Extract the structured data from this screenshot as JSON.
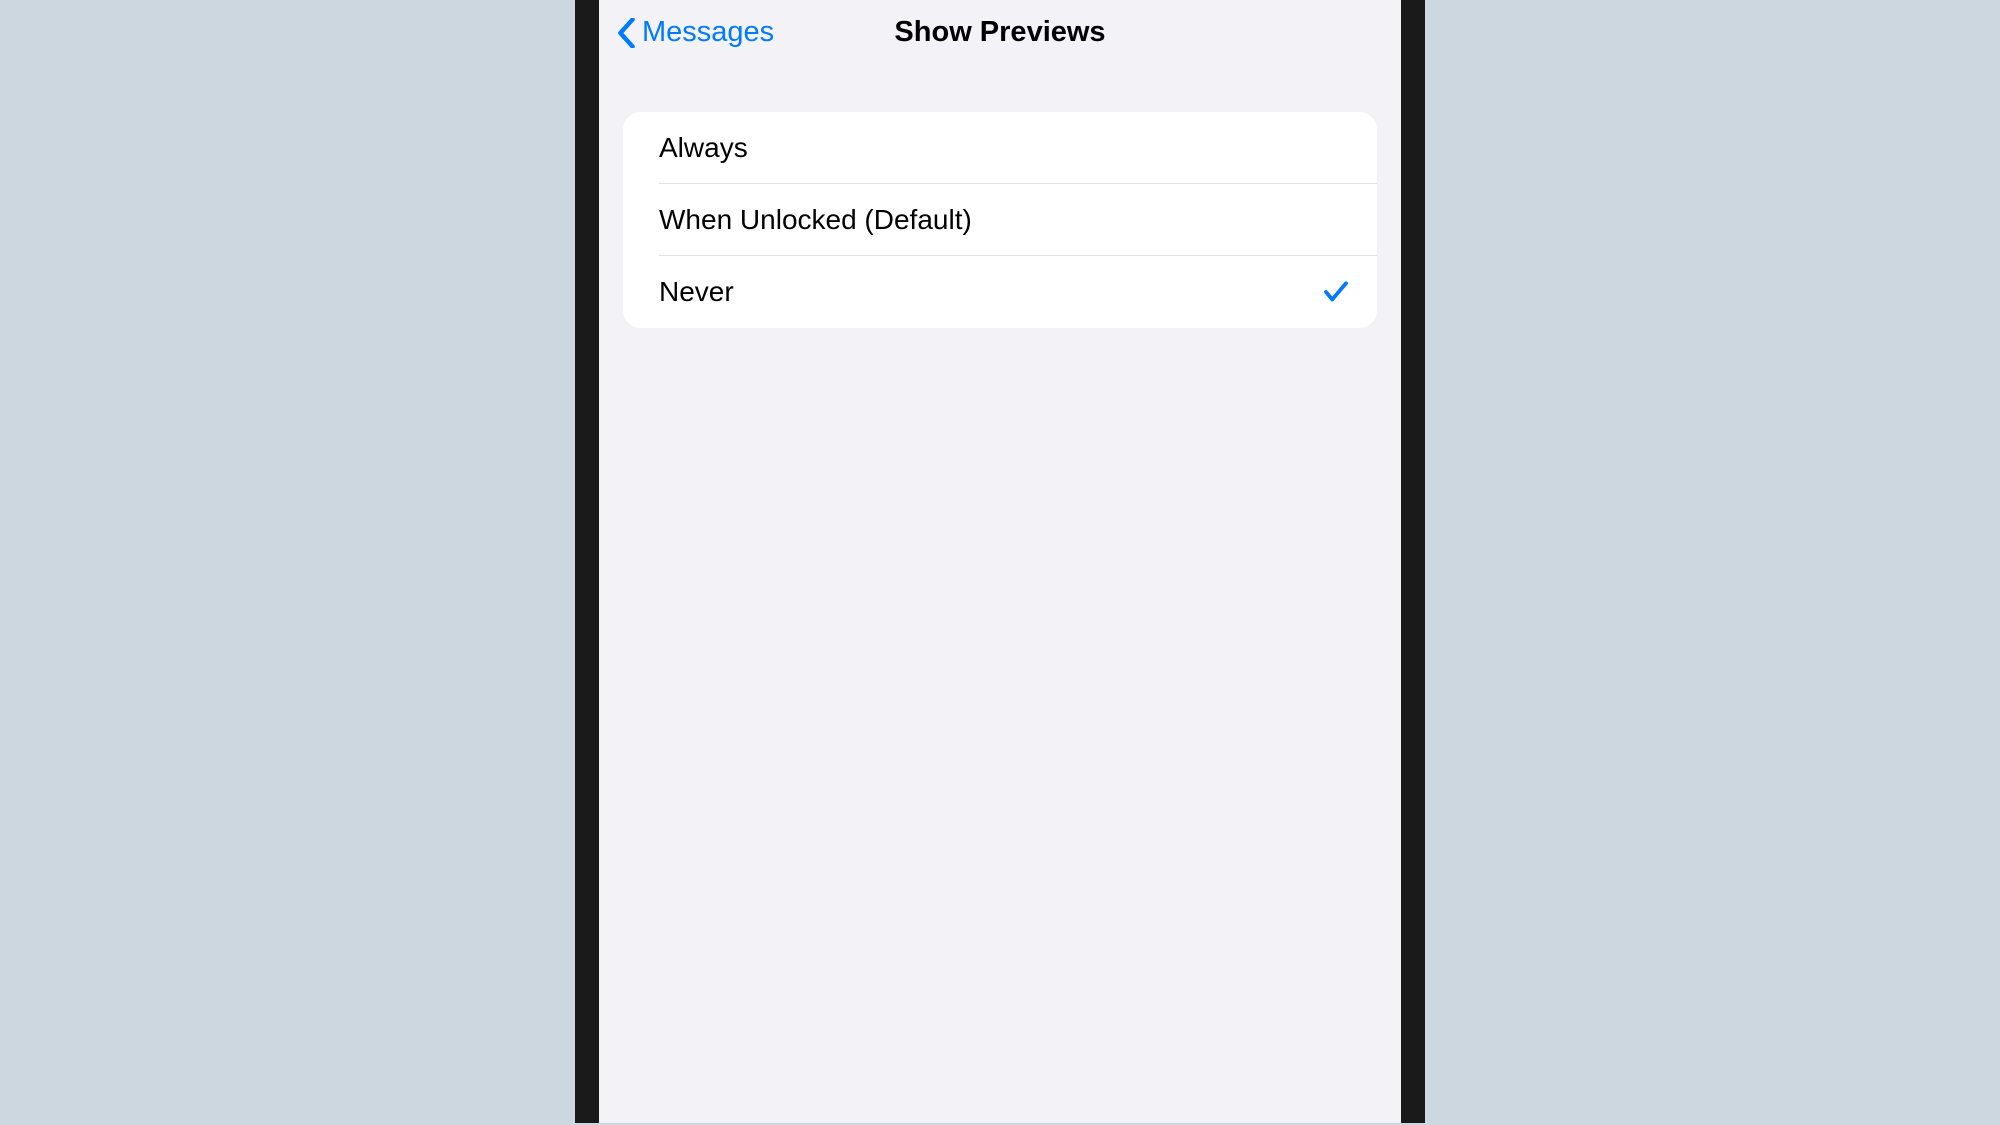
{
  "nav": {
    "back_label": "Messages",
    "title": "Show Previews"
  },
  "options": [
    {
      "label": "Always",
      "selected": false
    },
    {
      "label": "When Unlocked (Default)",
      "selected": false
    },
    {
      "label": "Never",
      "selected": true
    }
  ]
}
